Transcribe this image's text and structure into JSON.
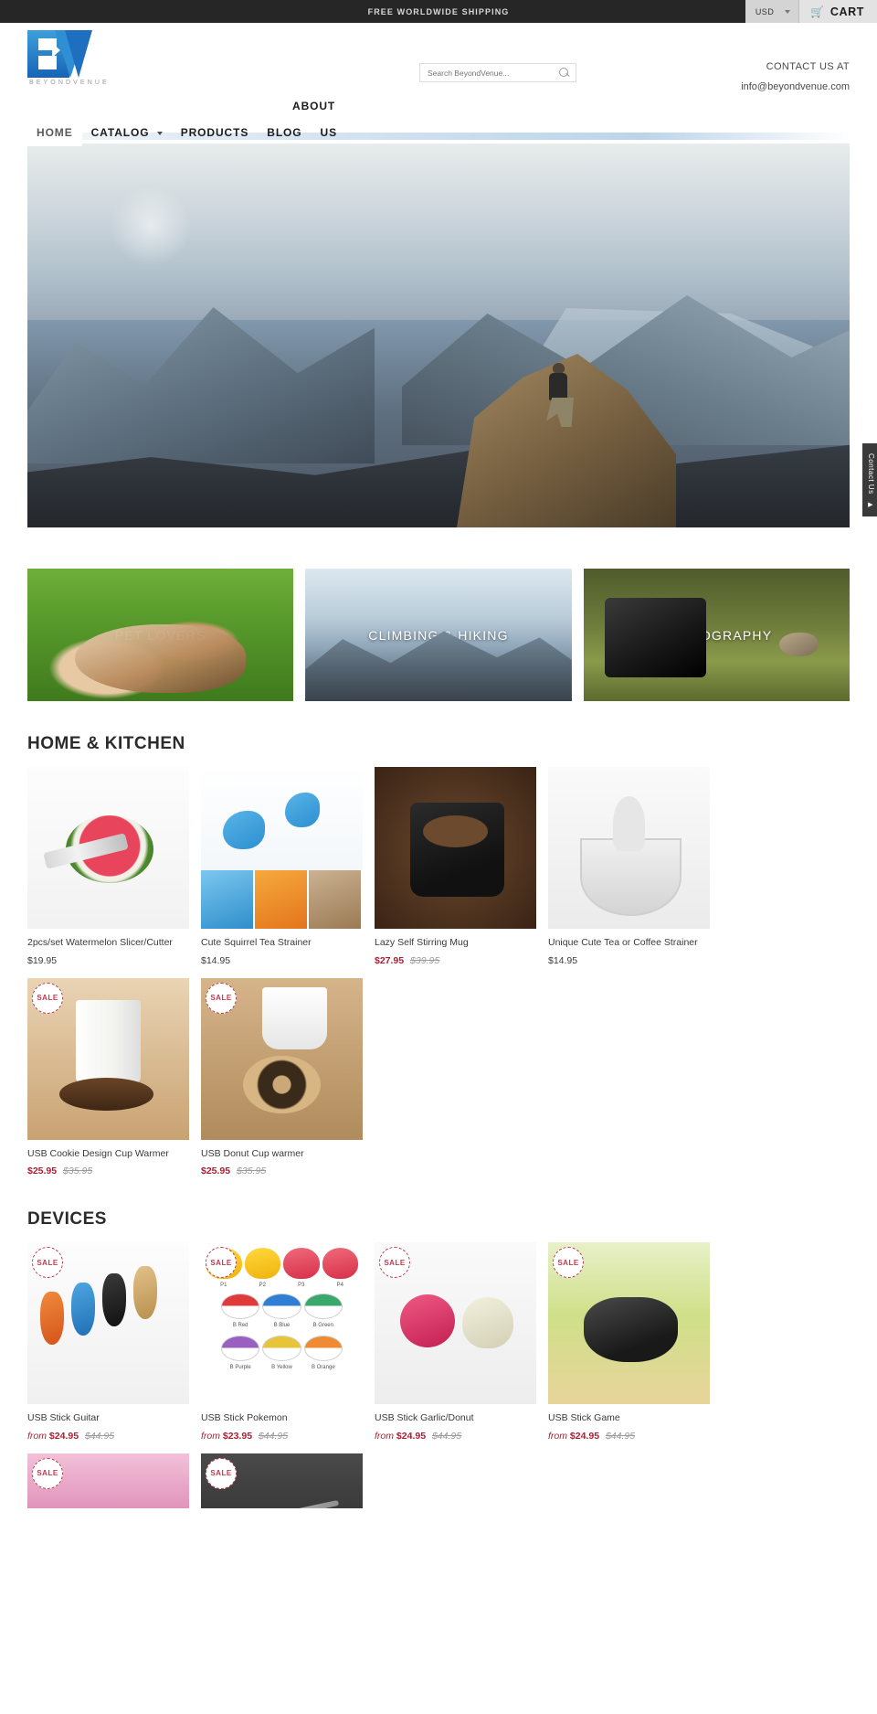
{
  "topbar": {
    "message": "FREE WORLDWIDE SHIPPING",
    "currency": "USD",
    "cart_label": "CART",
    "cart_icon": "shopping-cart-icon"
  },
  "header": {
    "logo_text": "BEYONDVENUE",
    "search_placeholder": "Search BeyondVenue...",
    "search_value": "",
    "search_icon": "search-icon",
    "contact_label": "CONTACT US AT",
    "contact_email": "info@beyondvenue.com"
  },
  "nav": {
    "items": [
      {
        "label": "HOME",
        "active": true,
        "caret": false
      },
      {
        "label": "CATALOG",
        "active": false,
        "caret": true
      },
      {
        "label": "PRODUCTS",
        "active": false,
        "caret": false
      },
      {
        "label": "BLOG",
        "active": false,
        "caret": false
      },
      {
        "label": "US",
        "active": false,
        "caret": false
      }
    ],
    "about_label": "ABOUT"
  },
  "side_tab": {
    "label": "Contact Us",
    "arrow": "▶"
  },
  "categories": [
    {
      "label": "PET LOVERS"
    },
    {
      "label": "CLIMBING & HIKING"
    },
    {
      "label": "PHOTOGRAPHY"
    }
  ],
  "sections": [
    {
      "title": "HOME & KITCHEN",
      "products": [
        {
          "title": "2pcs/set Watermelon Slicer/Cutter",
          "price": "$19.95",
          "old_price": "",
          "from": "",
          "sale": false,
          "badge": ""
        },
        {
          "title": "Cute Squirrel Tea Strainer",
          "price": "$14.95",
          "old_price": "",
          "from": "",
          "sale": false,
          "badge": ""
        },
        {
          "title": "Lazy Self Stirring Mug",
          "price": "$27.95",
          "old_price": "$39.95",
          "from": "",
          "sale": true,
          "badge": ""
        },
        {
          "title": "Unique Cute Tea or Coffee Strainer",
          "price": "$14.95",
          "old_price": "",
          "from": "",
          "sale": false,
          "badge": ""
        },
        {
          "title": "USB Cookie Design Cup Warmer",
          "price": "$25.95",
          "old_price": "$35.95",
          "from": "",
          "sale": true,
          "badge": "SALE"
        },
        {
          "title": "USB Donut Cup warmer",
          "price": "$25.95",
          "old_price": "$35.95",
          "from": "",
          "sale": true,
          "badge": "SALE"
        }
      ]
    },
    {
      "title": "DEVICES",
      "products": [
        {
          "title": "USB Stick Guitar",
          "price": "$24.95",
          "old_price": "$44.95",
          "from": "from",
          "sale": true,
          "badge": "SALE"
        },
        {
          "title": "USB Stick Pokemon",
          "price": "$23.95",
          "old_price": "$44.95",
          "from": "from",
          "sale": true,
          "badge": "SALE"
        },
        {
          "title": "USB Stick Garlic/Donut",
          "price": "$24.95",
          "old_price": "$44.95",
          "from": "from",
          "sale": true,
          "badge": "SALE"
        },
        {
          "title": "USB Stick Game",
          "price": "$24.95",
          "old_price": "$44.95",
          "from": "from",
          "sale": true,
          "badge": "SALE"
        }
      ]
    }
  ],
  "pokemon_labels": {
    "row1": [
      "P1",
      "P2",
      "P3",
      "P4"
    ],
    "row2": [
      "B Red",
      "B Blue",
      "B Green"
    ],
    "row3": [
      "B Purple",
      "B Yellow",
      "B Orange"
    ]
  },
  "colors": {
    "topbar_bg": "#262626",
    "sale_price": "#a81f32",
    "logo_blue": "#2f8fd4"
  }
}
